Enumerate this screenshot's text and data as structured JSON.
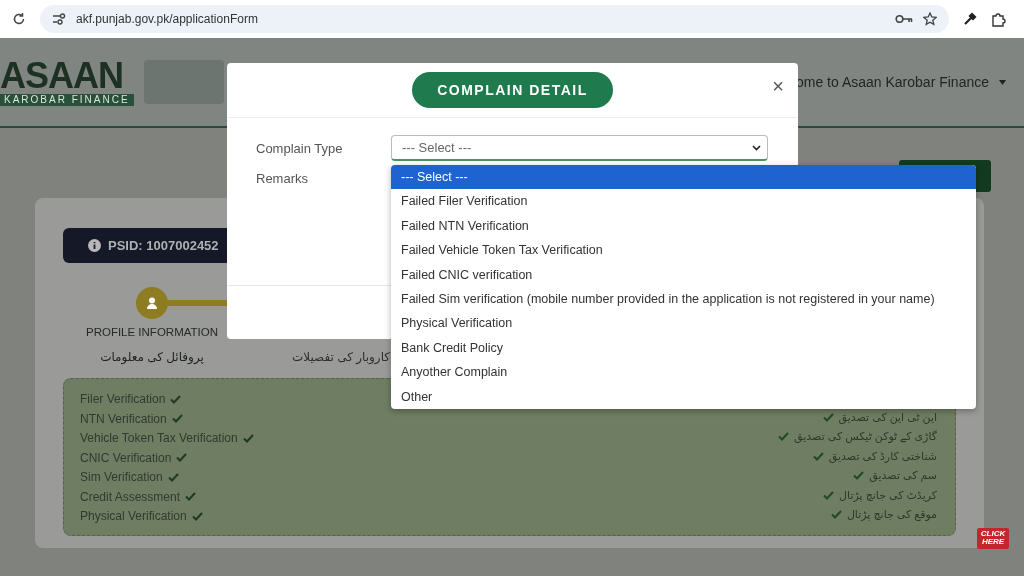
{
  "browser": {
    "url": "akf.punjab.gov.pk/applicationForm"
  },
  "header": {
    "logo_title": "ASAAN",
    "logo_subtitle": "KAROBAR FINANCE",
    "welcome": "ome to Asaan Karobar Finance"
  },
  "card": {
    "psid": "PSID: 1007002452",
    "profile_step": {
      "label": "PROFILE INFORMATION",
      "urdu": "پروفائل کی معلومات",
      "selected": true
    },
    "business_step": {
      "urdu": "کاروبار کی تفصیلات",
      "selected": false
    },
    "checks": [
      {
        "label": "Filer Verification",
        "checked": true
      },
      {
        "label": "NTN Verification",
        "checked": true
      },
      {
        "label": "Vehicle Token Tax Verification",
        "checked": true
      },
      {
        "label": "CNIC Verification",
        "checked": true
      },
      {
        "label": "Sim Verification",
        "checked": true
      },
      {
        "label": "Credit Assessment",
        "checked": true
      },
      {
        "label": "Physical Verification",
        "checked": true
      }
    ],
    "urdu_checks": [
      {
        "label": "این ٹی این کی تصدیق",
        "checked": true
      },
      {
        "label": "گاڑی کے ٹوکن ٹیکس کی تصدیق",
        "checked": true
      },
      {
        "label": "شناختی کارڈ کی تصدیق",
        "checked": true
      },
      {
        "label": "سم کی تصدیق",
        "checked": true
      },
      {
        "label": "کریڈٹ کی جانچ پڑتال",
        "checked": true
      },
      {
        "label": "موقع کی جانچ پڑتال",
        "checked": true
      }
    ]
  },
  "badge": "CLICK HERE",
  "modal": {
    "title": "COMPLAIN DETAIL",
    "close": "×",
    "fields": [
      {
        "label": "Complain Type",
        "kind": "select",
        "value": "--- Select ---"
      },
      {
        "label": "Remarks",
        "kind": "textarea"
      }
    ],
    "options": [
      {
        "label": "--- Select ---",
        "selected": true
      },
      {
        "label": "Failed Filer Verification",
        "selected": false
      },
      {
        "label": "Failed NTN Verification",
        "selected": false
      },
      {
        "label": "Failed Vehicle Token Tax Verification",
        "selected": false
      },
      {
        "label": "Failed CNIC verification",
        "selected": false
      },
      {
        "label": "Failed Sim verification (mobile number provided in the application is not registered in your name)",
        "selected": false
      },
      {
        "label": "Physical Verification",
        "selected": false
      },
      {
        "label": "Bank Credit Policy",
        "selected": false
      },
      {
        "label": "Anyother Complain",
        "selected": false
      },
      {
        "label": "Other",
        "selected": false
      }
    ]
  }
}
